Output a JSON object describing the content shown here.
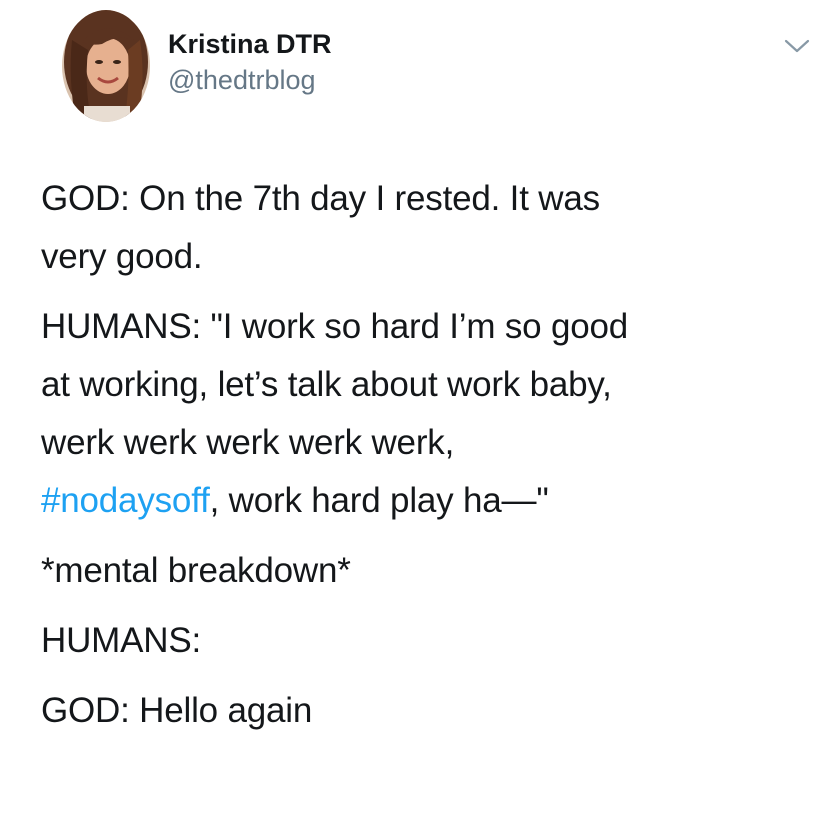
{
  "author": {
    "display_name": "Kristina DTR",
    "handle": "@thedtrblog",
    "avatar_icon": "profile-photo",
    "menu_icon": "chevron-down-icon"
  },
  "tweet": {
    "p1_line1": "GOD: On the 7th day I rested. It was",
    "p1_line2": "very good.",
    "p2_line1": "HUMANS: \"I work so hard I’m so good",
    "p2_line2": "at working, let’s talk about work baby,",
    "p2_line3": "werk werk werk werk werk,",
    "p2_hashtag": "#nodaysoff",
    "p2_line4_rest": ", work hard play ha—\"",
    "p3": "*mental breakdown*",
    "p4": "HUMANS:",
    "p5": "GOD: Hello again"
  },
  "colors": {
    "text": "#14171a",
    "secondary": "#657786",
    "hashtag": "#1da1f2"
  }
}
